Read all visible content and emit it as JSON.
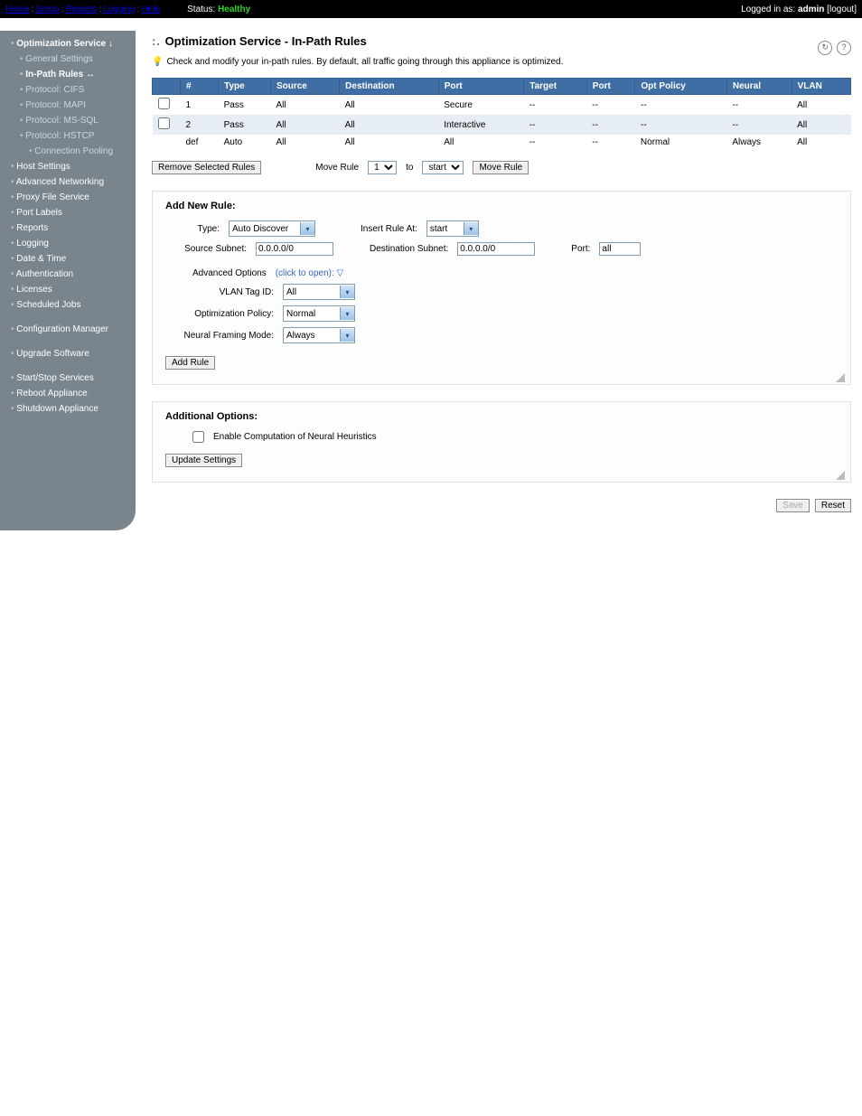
{
  "topnav": {
    "items": [
      "Home",
      "Setup",
      "Reports",
      "Logging",
      "Help"
    ],
    "status_label": "Status:",
    "status_value": "Healthy",
    "login_prefix": "Logged in as:",
    "user": "admin",
    "logout": "logout"
  },
  "sidebar": {
    "groups": [
      {
        "label": "Optimization Service",
        "arrow": "↓",
        "cls": "head bullet"
      },
      {
        "label": "General Settings",
        "cls": "sub1 bullet"
      },
      {
        "label": "In-Path Rules ↔",
        "cls": "sub1 active bullet"
      },
      {
        "label": "Protocol: CIFS",
        "cls": "sub1 bullet"
      },
      {
        "label": "Protocol: MAPI",
        "cls": "sub1 bullet"
      },
      {
        "label": "Protocol: MS-SQL",
        "cls": "sub1 bullet"
      },
      {
        "label": "Protocol: HSTCP",
        "cls": "sub1 bullet"
      },
      {
        "label": "Connection Pooling",
        "cls": "sub2 bullet"
      },
      {
        "label": "Host Settings",
        "cls": "bullet"
      },
      {
        "label": "Advanced Networking",
        "cls": "bullet"
      },
      {
        "label": "Proxy File Service",
        "cls": "bullet"
      },
      {
        "label": "Port Labels",
        "cls": "bullet"
      },
      {
        "label": "Reports",
        "cls": "bullet"
      },
      {
        "label": "Logging",
        "cls": "bullet"
      },
      {
        "label": "Date & Time",
        "cls": "bullet"
      },
      {
        "label": "Authentication",
        "cls": "bullet"
      },
      {
        "label": "Licenses",
        "cls": "bullet"
      },
      {
        "label": "Scheduled Jobs",
        "cls": "bullet"
      },
      {
        "gap": true
      },
      {
        "label": "Configuration Manager",
        "cls": "bullet"
      },
      {
        "gap": true
      },
      {
        "label": "Upgrade Software",
        "cls": "bullet"
      },
      {
        "gap": true
      },
      {
        "label": "Start/Stop Services",
        "cls": "bullet"
      },
      {
        "label": "Reboot Appliance",
        "cls": "bullet"
      },
      {
        "label": "Shutdown Appliance",
        "cls": "bullet"
      }
    ]
  },
  "page": {
    "title": "Optimization Service - In-Path Rules",
    "desc": "Check and modify your in-path rules. By default, all traffic going through this appliance is optimized."
  },
  "table": {
    "headers": [
      "#",
      "Type",
      "Source",
      "Destination",
      "Port",
      "Target",
      "Port",
      "Opt Policy",
      "Neural",
      "VLAN"
    ],
    "rows": [
      {
        "chk": true,
        "num": "1",
        "type": "Pass",
        "src": "All",
        "dst": "All",
        "port": "Secure",
        "target": "--",
        "tport": "--",
        "opt": "--",
        "neu": "--",
        "vlan": "All",
        "alt": false
      },
      {
        "chk": true,
        "num": "2",
        "type": "Pass",
        "src": "All",
        "dst": "All",
        "port": "Interactive",
        "target": "--",
        "tport": "--",
        "opt": "--",
        "neu": "--",
        "vlan": "All",
        "alt": true
      },
      {
        "chk": false,
        "num": "def",
        "type": "Auto",
        "src": "All",
        "dst": "All",
        "port": "All",
        "target": "--",
        "tport": "--",
        "opt": "Normal",
        "neu": "Always",
        "vlan": "All",
        "alt": false
      }
    ]
  },
  "toolbar": {
    "remove": "Remove Selected Rules",
    "move_label": "Move Rule",
    "move_num": "1",
    "to": "to",
    "move_pos": "start",
    "move_btn": "Move Rule"
  },
  "addrule": {
    "title": "Add New Rule:",
    "type_label": "Type:",
    "type_val": "Auto Discover",
    "insert_label": "Insert Rule At:",
    "insert_val": "start",
    "srcsub_label": "Source Subnet:",
    "srcsub_val": "0.0.0.0/0",
    "dstsub_label": "Destination Subnet:",
    "dstsub_val": "0.0.0.0/0",
    "port_label": "Port:",
    "port_val": "all",
    "adv_label": "Advanced Options",
    "adv_action": "(click to open):",
    "vlan_label": "VLAN Tag ID:",
    "vlan_val": "All",
    "optpol_label": "Optimization Policy:",
    "optpol_val": "Normal",
    "neu_label": "Neural Framing Mode:",
    "neu_val": "Always",
    "add_btn": "Add Rule"
  },
  "addl": {
    "title": "Additional Options:",
    "chk_label": "Enable Computation of Neural Heuristics",
    "update_btn": "Update Settings"
  },
  "footer": {
    "save": "Save",
    "reset": "Reset"
  }
}
